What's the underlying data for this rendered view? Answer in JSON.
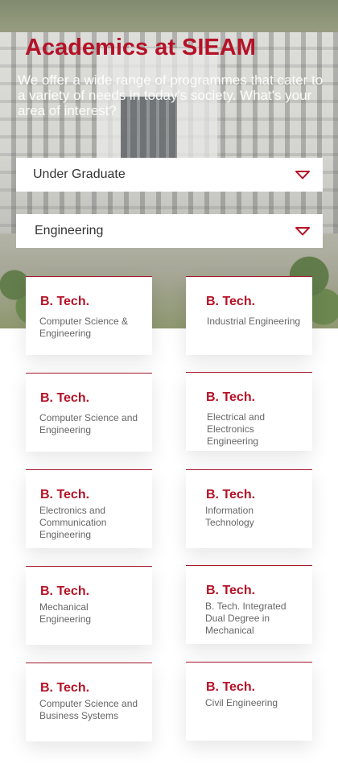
{
  "hero": {
    "title": "Academics at SIEAM",
    "subtitle": "We offer a wide range of programmes that cater to a variety of needs in today's society. What's your area of interest?"
  },
  "filters": {
    "level": {
      "value": "Under Graduate",
      "icon": "caret-down-icon"
    },
    "discipline": {
      "value": "Engineering",
      "icon": "caret-down-icon"
    }
  },
  "colors": {
    "accent": "#b51227",
    "card_border": "#a31a2c",
    "text_muted": "#666666"
  },
  "programmes": [
    {
      "degree": "B. Tech.",
      "name": "Computer Science & Engineering"
    },
    {
      "degree": "B. Tech.",
      "name": "Industrial Engineering"
    },
    {
      "degree": "B. Tech.",
      "name": "Computer Science and Engineering"
    },
    {
      "degree": "B. Tech.",
      "name": "Electrical and Electronics Engineering"
    },
    {
      "degree": "B. Tech.",
      "name": "Electronics and Communication Engineering"
    },
    {
      "degree": "B. Tech.",
      "name": "Information Technology"
    },
    {
      "degree": "B. Tech.",
      "name": "Mechanical Engineering"
    },
    {
      "degree": "B. Tech.",
      "name": "B. Tech. Integrated Dual Degree in Mechanical"
    },
    {
      "degree": "B. Tech.",
      "name": "Computer Science and Business Systems"
    },
    {
      "degree": "B. Tech.",
      "name": "Civil Engineering"
    }
  ]
}
